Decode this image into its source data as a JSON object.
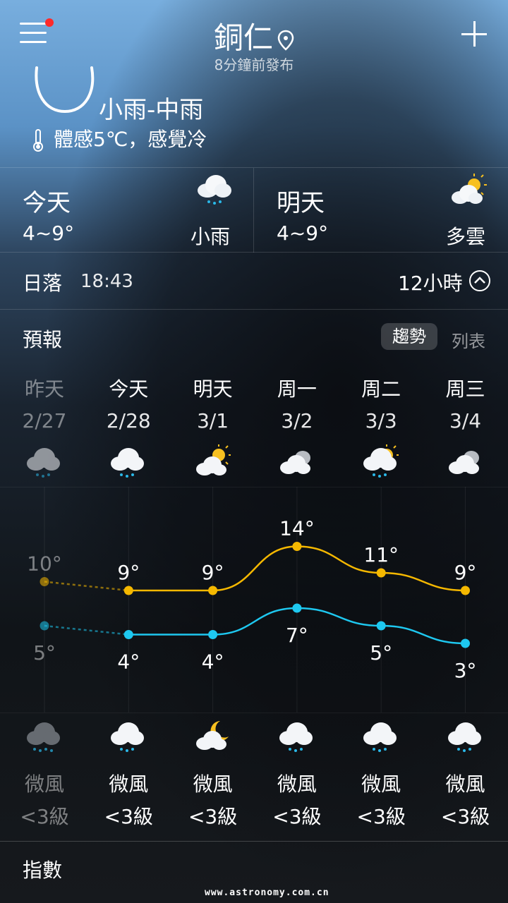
{
  "header": {
    "city": "銅仁",
    "published": "8分鐘前發布"
  },
  "current": {
    "condition": "小雨-中雨",
    "feels_like": "體感5℃，感覺冷"
  },
  "summary": {
    "today": {
      "label": "今天",
      "range": "4~9°",
      "condition": "小雨",
      "icon": "rain-cloud-icon"
    },
    "tomorrow": {
      "label": "明天",
      "range": "4~9°",
      "condition": "多雲",
      "icon": "partly-cloudy-icon"
    }
  },
  "sun": {
    "label": "日落",
    "time": "18:43",
    "hours": "12小時"
  },
  "forecast": {
    "title": "預報",
    "tabs": {
      "trend": "趨勢",
      "list": "列表"
    },
    "days": [
      {
        "name": "昨天",
        "date": "2/27",
        "high": "10°",
        "low": "5°",
        "day_icon": "rain-cloud-icon",
        "night_icon": "heavy-rain-cloud-icon",
        "wind": "微風",
        "level": "<3級"
      },
      {
        "name": "今天",
        "date": "2/28",
        "high": "9°",
        "low": "4°",
        "day_icon": "rain-cloud-icon",
        "night_icon": "rain-cloud-icon",
        "wind": "微風",
        "level": "<3級"
      },
      {
        "name": "明天",
        "date": "3/1",
        "high": "9°",
        "low": "4°",
        "day_icon": "partly-cloudy-icon",
        "night_icon": "moon-cloud-icon",
        "wind": "微風",
        "level": "<3級"
      },
      {
        "name": "周一",
        "date": "3/2",
        "high": "14°",
        "low": "7°",
        "day_icon": "cloudy-icon",
        "night_icon": "rain-cloud-icon",
        "wind": "微風",
        "level": "<3級"
      },
      {
        "name": "周二",
        "date": "3/3",
        "high": "11°",
        "low": "5°",
        "day_icon": "sun-rain-cloud-icon",
        "night_icon": "rain-cloud-icon",
        "wind": "微風",
        "level": "<3級"
      },
      {
        "name": "周三",
        "date": "3/4",
        "high": "9°",
        "low": "3°",
        "day_icon": "cloudy-icon",
        "night_icon": "rain-cloud-icon",
        "wind": "微風",
        "level": "<3級"
      }
    ]
  },
  "chart_data": {
    "type": "line",
    "categories": [
      "2/27",
      "2/28",
      "3/1",
      "3/2",
      "3/3",
      "3/4"
    ],
    "series": [
      {
        "values": [
          10,
          9,
          9,
          14,
          11,
          9
        ],
        "color": "#f5b800"
      },
      {
        "values": [
          5,
          4,
          4,
          7,
          5,
          3
        ],
        "color": "#1ec8f0"
      }
    ]
  },
  "index": {
    "title": "指數"
  },
  "watermark": "www.astronomy.com.cn",
  "colors": {
    "high": "#f5b800",
    "low": "#1ec8f0",
    "alert": "#ff2a2a"
  }
}
